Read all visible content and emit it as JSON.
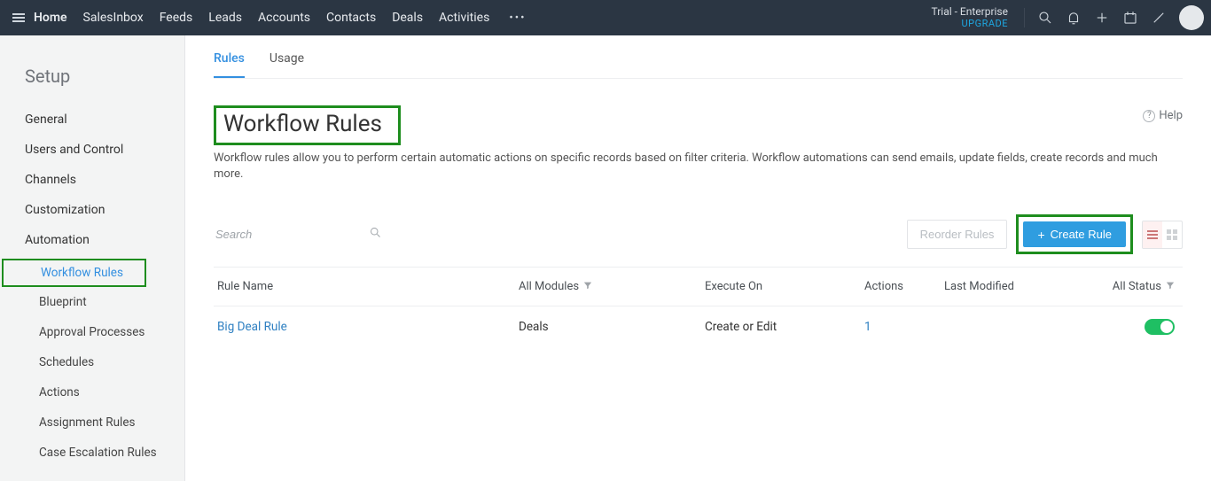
{
  "topnav": {
    "items": [
      "Home",
      "SalesInbox",
      "Feeds",
      "Leads",
      "Accounts",
      "Contacts",
      "Deals",
      "Activities"
    ],
    "trial": "Trial - Enterprise",
    "upgrade": "UPGRADE"
  },
  "sidebar": {
    "title": "Setup",
    "items": [
      "General",
      "Users and Control",
      "Channels",
      "Customization",
      "Automation"
    ],
    "automation_children": [
      "Workflow Rules",
      "Blueprint",
      "Approval Processes",
      "Schedules",
      "Actions",
      "Assignment Rules",
      "Case Escalation Rules"
    ]
  },
  "tabs": {
    "rules": "Rules",
    "usage": "Usage"
  },
  "page": {
    "title": "Workflow Rules",
    "desc": "Workflow rules allow you to perform certain automatic actions on specific records based on filter criteria. Workflow automations can send emails, update fields, create records and much more.",
    "help": "Help"
  },
  "toolbar": {
    "search_placeholder": "Search",
    "reorder": "Reorder Rules",
    "create": "Create Rule"
  },
  "table": {
    "headers": {
      "rule": "Rule Name",
      "modules": "All Modules",
      "execute": "Execute On",
      "actions": "Actions",
      "modified": "Last Modified",
      "status": "All Status"
    },
    "rows": [
      {
        "name": "Big Deal Rule",
        "module": "Deals",
        "execute": "Create or Edit",
        "actions": "1"
      }
    ]
  }
}
